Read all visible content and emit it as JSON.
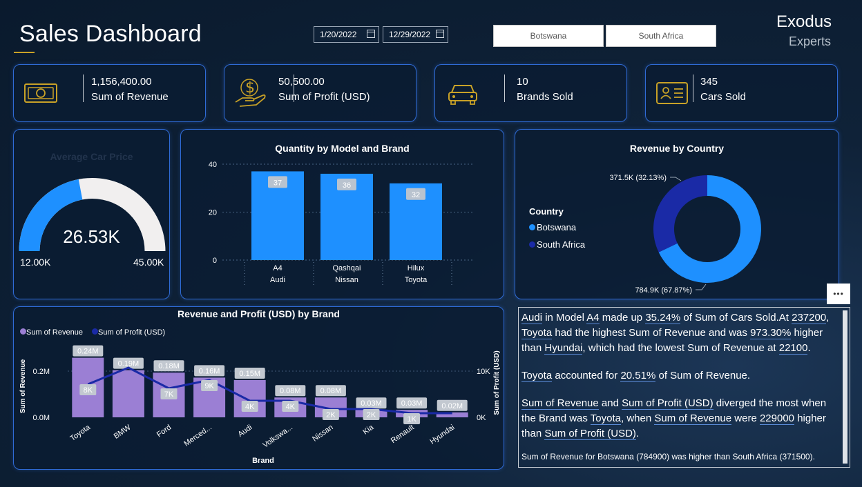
{
  "header": {
    "title": "Sales Dashboard",
    "date_start": "1/20/2022",
    "date_end": "12/29/2022",
    "slicer_options": [
      "Botswana",
      "South Africa"
    ],
    "brand_line1": "Exodus",
    "brand_line2": "Experts"
  },
  "colors": {
    "accent_blue": "#1e90ff",
    "card_border": "#2f6bd6",
    "gold": "#c9a227",
    "purple": "#9b7fd4",
    "navy": "#1a2aa6"
  },
  "kpis": [
    {
      "value": "1,156,400.00",
      "label": "Sum of Revenue",
      "icon": "money-bill-icon"
    },
    {
      "value": "50,500.00",
      "label": "Sum of Profit (USD)",
      "icon": "hand-dollar-icon"
    },
    {
      "value": "10",
      "label": "Brands Sold",
      "icon": "car-icon"
    },
    {
      "value": "345",
      "label": "Cars Sold",
      "icon": "id-card-icon"
    }
  ],
  "gauge": {
    "title": "Average Car Price",
    "value_label": "26.53K",
    "min_label": "12.00K",
    "max_label": "45.00K",
    "value": 26.53,
    "min": 12.0,
    "max": 45.0
  },
  "quantity_chart": {
    "title": "Quantity by Model and Brand",
    "chart_data": {
      "type": "bar",
      "categories": [
        [
          "A4",
          "Audi"
        ],
        [
          "Qashqai",
          "Nissan"
        ],
        [
          "Hilux",
          "Toyota"
        ]
      ],
      "values": [
        37,
        36,
        32
      ],
      "yticks": [
        "40",
        "20",
        "0"
      ],
      "ylim": [
        0,
        40
      ]
    }
  },
  "revenue_country": {
    "title": "Revenue by Country",
    "legend_title": "Country",
    "chart_data": {
      "type": "pie",
      "labels": [
        "Botswana",
        "South Africa"
      ],
      "values": [
        784.9,
        371.5
      ],
      "data_labels": [
        "784.9K (67.87%)",
        "371.5K (32.13%)"
      ],
      "colors": [
        "#1e90ff",
        "#1a2aa6"
      ]
    }
  },
  "rev_profit_chart": {
    "title": "Revenue and Profit (USD) by Brand",
    "legend": [
      "Sum of Revenue",
      "Sum of Profit (USD)"
    ],
    "ylabel_left": "Sum of Revenue",
    "ylabel_right": "Sum of Profit (USD)",
    "xlabel": "Brand",
    "left_ticks": [
      "0.2M",
      "0.0M"
    ],
    "right_ticks": [
      "10K",
      "0K"
    ],
    "chart_data": {
      "type": "bar",
      "categories": [
        "Toyota",
        "BMW",
        "Ford",
        "Merced...",
        "Audi",
        "Volkswa...",
        "Nissan",
        "Kia",
        "Renault",
        "Hyundai"
      ],
      "series": [
        {
          "name": "Sum of Revenue",
          "values": [
            0.24,
            0.19,
            0.18,
            0.16,
            0.15,
            0.08,
            0.08,
            0.03,
            0.03,
            0.02
          ],
          "labels": [
            "0.24M",
            "0.19M",
            "0.18M",
            "0.16M",
            "0.15M",
            "0.08M",
            "0.08M",
            "0.03M",
            "0.03M",
            "0.02M"
          ]
        },
        {
          "name": "Sum of Profit (USD)",
          "values": [
            8,
            12,
            7,
            9,
            4,
            4,
            2,
            2,
            1,
            1
          ],
          "labels": [
            "8K",
            "",
            "7K",
            "9K",
            "4K",
            "4K",
            "2K",
            "2K",
            "1K",
            ""
          ]
        }
      ],
      "ylim_left": [
        0,
        0.25
      ],
      "ylim_right": [
        0,
        15
      ]
    }
  },
  "narrative": {
    "p1": [
      {
        "t": "Audi",
        "u": true
      },
      {
        "t": " in Model ",
        "u": false
      },
      {
        "t": "A4",
        "u": true
      },
      {
        "t": " made up ",
        "u": false
      },
      {
        "t": "35.24%",
        "u": true
      },
      {
        "t": " of Sum of Cars Sold.At ",
        "u": false
      },
      {
        "t": "237200",
        "u": true
      },
      {
        "t": ", ",
        "u": false
      },
      {
        "t": "Toyota",
        "u": true
      },
      {
        "t": " had the highest Sum of Revenue and was ",
        "u": false
      },
      {
        "t": "973.30%",
        "u": true
      },
      {
        "t": " higher than ",
        "u": false
      },
      {
        "t": "Hyundai",
        "u": true
      },
      {
        "t": ", which had the lowest Sum of Revenue at ",
        "u": false
      },
      {
        "t": "22100",
        "u": true
      },
      {
        "t": ".",
        "u": false
      }
    ],
    "p2": [
      {
        "t": "Toyota",
        "u": true
      },
      {
        "t": " accounted for ",
        "u": false
      },
      {
        "t": "20.51%",
        "u": true
      },
      {
        "t": " of Sum of Revenue.",
        "u": false
      }
    ],
    "p3": [
      {
        "t": "Sum of Revenue",
        "u": true
      },
      {
        "t": " and ",
        "u": false
      },
      {
        "t": "Sum of Profit (USD)",
        "u": true
      },
      {
        "t": " diverged the most when the Brand was ",
        "u": false
      },
      {
        "t": "Toyota",
        "u": true
      },
      {
        "t": ", when ",
        "u": false
      },
      {
        "t": "Sum of Revenue",
        "u": true
      },
      {
        "t": " were ",
        "u": false
      },
      {
        "t": "229000",
        "u": true
      },
      {
        "t": " higher than ",
        "u": false
      },
      {
        "t": "Sum of Profit (USD)",
        "u": true
      },
      {
        "t": ".",
        "u": false
      }
    ],
    "p4": "Sum of Revenue for Botswana (784900) was higher than South Africa (371500).",
    "more_label": "•••"
  }
}
